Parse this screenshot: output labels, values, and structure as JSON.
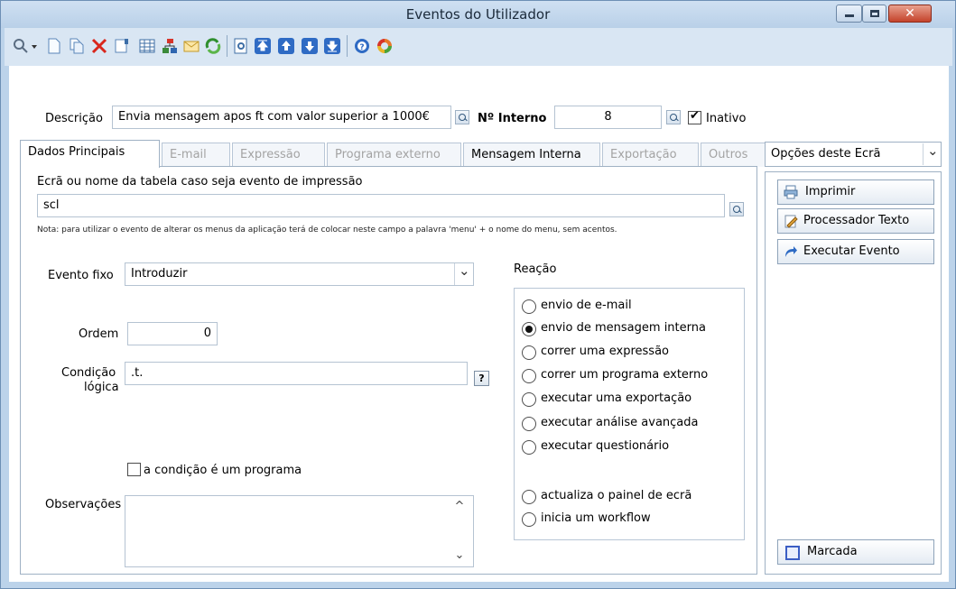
{
  "window": {
    "title": "Eventos do Utilizador",
    "close_label": "✕"
  },
  "toolbar": {
    "icons": [
      "search-icon",
      "new-document-icon",
      "copy-document-icon",
      "delete-icon",
      "edit-icon",
      "grid-icon",
      "hierarchy-icon",
      "mail-icon",
      "refresh-icon",
      "preview-icon",
      "first-record-icon",
      "previous-record-icon",
      "next-record-icon",
      "last-record-icon",
      "help-icon",
      "sync-icon"
    ]
  },
  "header": {
    "descricao_label": "Descrição",
    "descricao_value": "Envia mensagem apos ft com valor superior a 1000€",
    "interno_label": "Nº Interno",
    "interno_value": "8",
    "inativo_label": "Inativo",
    "inativo_checked": true
  },
  "tabs": [
    {
      "label": "Dados Principais",
      "state": "active"
    },
    {
      "label": "E-mail",
      "state": "disabled"
    },
    {
      "label": "Expressão",
      "state": "disabled"
    },
    {
      "label": "Programa externo",
      "state": "disabled"
    },
    {
      "label": "Mensagem Interna",
      "state": "enabled"
    },
    {
      "label": "Exportação",
      "state": "disabled"
    },
    {
      "label": "Outros",
      "state": "disabled"
    }
  ],
  "main": {
    "tabela_label": "Ecrã ou nome da tabela caso seja evento de impressão",
    "tabela_value": "scl",
    "nota": "Nota: para utilizar o evento de alterar os menus da aplicação terá de colocar neste campo a palavra 'menu' + o nome do menu, sem acentos.",
    "evento_fixo_label": "Evento fixo",
    "evento_fixo_value": "Introduzir",
    "ordem_label": "Ordem",
    "ordem_value": "0",
    "condicao_label_1": "Condição",
    "condicao_label_2": "lógica",
    "condicao_value": ".t.",
    "help_label": "?",
    "condicao_programa_label": "a condição é um programa",
    "condicao_programa_checked": false,
    "observacoes_label": "Observações",
    "observacoes_value": "",
    "scroll_up": "^",
    "scroll_down": "⌄"
  },
  "reacao": {
    "title": "Reação",
    "options": [
      {
        "label": "envio de e-mail",
        "selected": false
      },
      {
        "label": "envio de mensagem interna",
        "selected": true
      },
      {
        "label": "correr uma expressão",
        "selected": false
      },
      {
        "label": "correr um programa externo",
        "selected": false
      },
      {
        "label": "executar uma exportação",
        "selected": false
      },
      {
        "label": "executar análise avançada",
        "selected": false
      },
      {
        "label": "executar questionário",
        "selected": false
      },
      {
        "label": "actualiza o painel de ecrã",
        "selected": false
      },
      {
        "label": "inicia um workflow",
        "selected": false
      }
    ]
  },
  "sidebar": {
    "combo_label": "Opções deste Ecrã",
    "buttons": [
      {
        "label": "Imprimir",
        "icon": "printer-icon"
      },
      {
        "label": "Processador Texto",
        "icon": "text-editor-icon"
      },
      {
        "label": "Executar Evento",
        "icon": "execute-arrow-icon"
      }
    ],
    "marcada_label": "Marcada"
  },
  "colors": {
    "window_border": "#bcd3ea",
    "accent": "#1f6fc5"
  }
}
